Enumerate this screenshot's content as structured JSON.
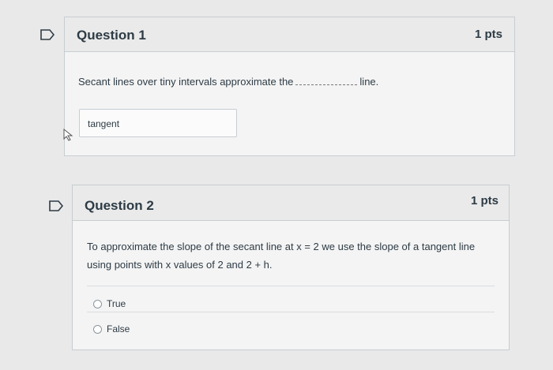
{
  "questions": [
    {
      "title": "Question 1",
      "points": "1 pts",
      "text_before": "Secant lines over tiny intervals approximate the",
      "text_after": "line.",
      "answer": "tangent"
    },
    {
      "title": "Question 2",
      "points": "1 pts",
      "text_line1": "To approximate the slope of the secant line at x = 2 we use the slope of a tangent line",
      "text_line2": "using points with x values of 2 and 2 + h.",
      "options": [
        "True",
        "False"
      ]
    }
  ],
  "colors": {
    "flag_accent": "#2d3b45",
    "background": "#e9e9e9"
  }
}
